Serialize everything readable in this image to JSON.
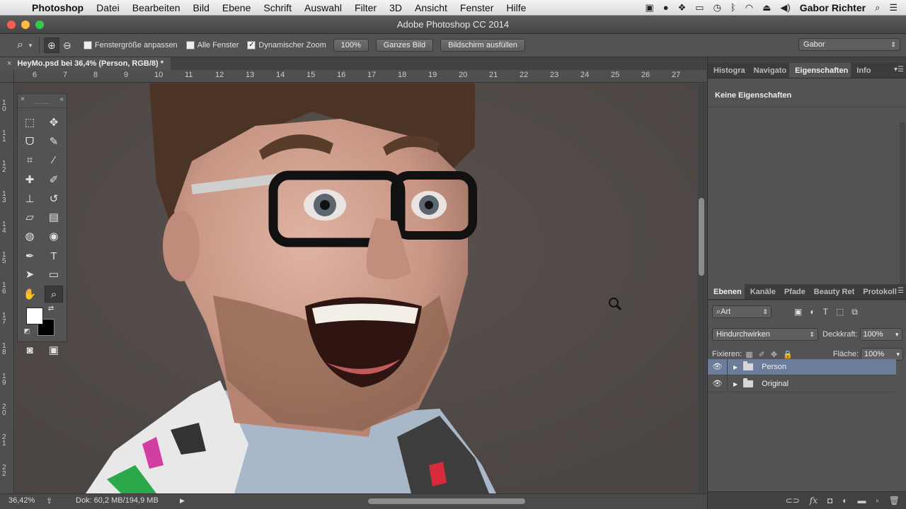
{
  "menubar": {
    "items": [
      "Photoshop",
      "Datei",
      "Bearbeiten",
      "Bild",
      "Ebene",
      "Schrift",
      "Auswahl",
      "Filter",
      "3D",
      "Ansicht",
      "Fenster",
      "Hilfe"
    ],
    "user": "Gabor Richter"
  },
  "window": {
    "title": "Adobe Photoshop CC 2014"
  },
  "options": {
    "chk_window": "Fenstergröße anpassen",
    "chk_all": "Alle Fenster",
    "chk_dynamic": "Dynamischer Zoom",
    "zoom_percent": "100%",
    "btn_fit": "Ganzes Bild",
    "btn_fill": "Bildschirm ausfüllen",
    "workspace": "Gabor"
  },
  "document": {
    "tab_title": "HeyMo.psd bei 36,4% (Person, RGB/8) *",
    "close": "×"
  },
  "ruler": {
    "h_labels": [
      "6",
      "7",
      "8",
      "9",
      "10",
      "11",
      "12",
      "13",
      "14",
      "15",
      "16",
      "17",
      "18",
      "19",
      "20",
      "21",
      "22",
      "23",
      "24",
      "25",
      "26",
      "27"
    ],
    "v_labels": [
      "1 0",
      "1 1",
      "1 2",
      "1 3",
      "1 4",
      "1 5",
      "1 6",
      "1 7",
      "1 8",
      "1 9",
      "2 0",
      "2 1",
      "2 2"
    ]
  },
  "status": {
    "zoom": "36,42%",
    "doc": "Dok: 60,2 MB/194,9 MB"
  },
  "panels": {
    "top_tabs": [
      "Histogra",
      "Navigato",
      "Eigenschaften",
      "Info"
    ],
    "properties_text": "Keine Eigenschaften",
    "layer_tabs": [
      "Ebenen",
      "Kanäle",
      "Pfade",
      "Beauty Ret",
      "Protokoll"
    ],
    "filter": "Art",
    "blend_mode": "Hindurchwirken",
    "opacity_label": "Deckkraft:",
    "opacity": "100%",
    "lock_label": "Fixieren:",
    "fill_label": "Fläche:",
    "fill": "100%",
    "layers": [
      {
        "name": "Person",
        "selected": true
      },
      {
        "name": "Original",
        "selected": false
      }
    ]
  }
}
